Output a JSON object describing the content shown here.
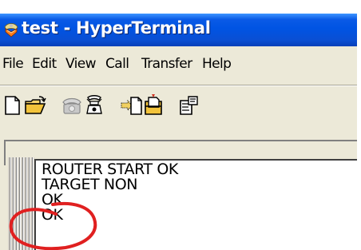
{
  "window": {
    "title": "test - HyperTerminal",
    "app_icon": "hyperterminal-icon"
  },
  "menubar": {
    "items": [
      "File",
      "Edit",
      "View",
      "Call",
      "Transfer",
      "Help"
    ]
  },
  "toolbar": {
    "buttons": [
      {
        "icon": "new-document-icon"
      },
      {
        "icon": "open-folder-icon"
      },
      {
        "icon": "connect-phone-icon"
      },
      {
        "icon": "disconnect-icon"
      },
      {
        "icon": "send-file-icon"
      },
      {
        "icon": "receive-file-icon"
      },
      {
        "icon": "properties-icon"
      }
    ]
  },
  "terminal": {
    "lines": [
      "ROUTER START OK",
      "TARGET NON",
      "OK",
      "OK"
    ]
  },
  "annotation": {
    "color": "#e02020",
    "highlight_target": "OK lines"
  }
}
